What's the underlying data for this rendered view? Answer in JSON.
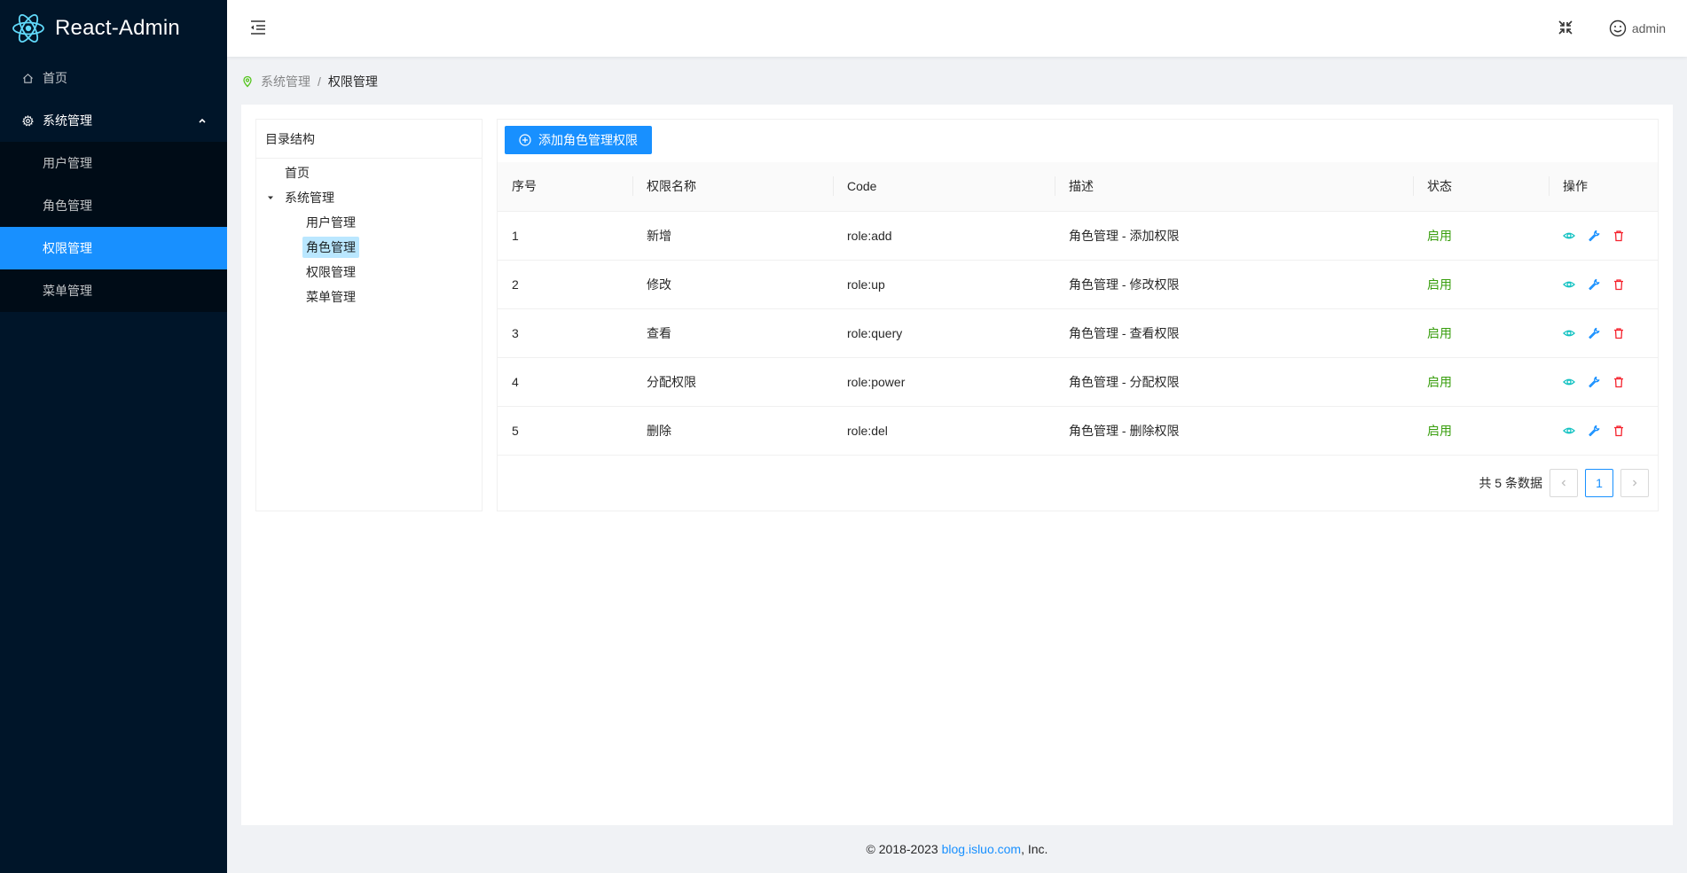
{
  "app": {
    "title": "React-Admin"
  },
  "sidebar": {
    "items": [
      {
        "label": "首页",
        "icon": "home-icon"
      },
      {
        "label": "系统管理",
        "icon": "setting-icon",
        "open": true,
        "children": [
          {
            "label": "用户管理"
          },
          {
            "label": "角色管理"
          },
          {
            "label": "权限管理",
            "active": true
          },
          {
            "label": "菜单管理"
          }
        ]
      }
    ]
  },
  "header": {
    "user_name": "admin",
    "fold_icon": "menu-fold-icon",
    "fullscreen_icon": "fullscreen-icon",
    "user_icon": "smile-icon"
  },
  "breadcrumb": {
    "items": [
      "系统管理",
      "权限管理"
    ],
    "separator": "/"
  },
  "tree": {
    "title": "目录结构",
    "nodes": [
      {
        "label": "首页"
      },
      {
        "label": "系统管理",
        "expanded": true
      },
      {
        "label": "用户管理"
      },
      {
        "label": "角色管理",
        "selected": true
      },
      {
        "label": "权限管理"
      },
      {
        "label": "菜单管理"
      }
    ]
  },
  "toolbar": {
    "add_label": "添加角色管理权限"
  },
  "table": {
    "columns": [
      "序号",
      "权限名称",
      "Code",
      "描述",
      "状态",
      "操作"
    ],
    "rows": [
      {
        "no": "1",
        "name": "新增",
        "code": "role:add",
        "desc": "角色管理 - 添加权限",
        "status": "启用"
      },
      {
        "no": "2",
        "name": "修改",
        "code": "role:up",
        "desc": "角色管理 - 修改权限",
        "status": "启用"
      },
      {
        "no": "3",
        "name": "查看",
        "code": "role:query",
        "desc": "角色管理 - 查看权限",
        "status": "启用"
      },
      {
        "no": "4",
        "name": "分配权限",
        "code": "role:power",
        "desc": "角色管理 - 分配权限",
        "status": "启用"
      },
      {
        "no": "5",
        "name": "删除",
        "code": "role:del",
        "desc": "角色管理 - 删除权限",
        "status": "启用"
      }
    ]
  },
  "pagination": {
    "total_text": "共 5 条数据",
    "current": "1"
  },
  "footer": {
    "prefix": "© 2018-2023 ",
    "link": "blog.isluo.com",
    "suffix": ", Inc."
  },
  "colors": {
    "primary": "#1890ff",
    "sider": "#001529",
    "submenu": "#000c17",
    "status_on": "#389e0d",
    "view_icon": "#13c2c2",
    "edit_icon": "#1890ff",
    "delete_icon": "#f5222d"
  }
}
